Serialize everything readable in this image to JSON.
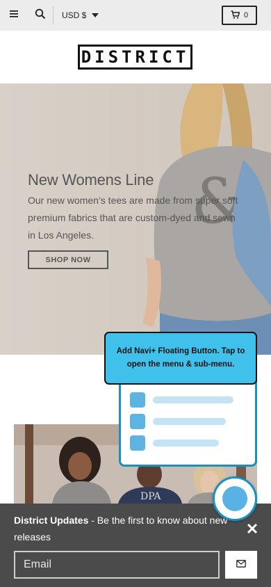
{
  "topbar": {
    "currency": "USD $",
    "cart_count": "0"
  },
  "header": {
    "logo": "DISTRICT"
  },
  "hero": {
    "title": "New Womens Line",
    "text": "Our new women’s tees are made from super soft premium fabrics that are custom-dyed and sewn in Los Angeles.",
    "button_label": "SHOP NOW"
  },
  "floating_button": {
    "tooltip": "Add Navi+ Floating Button. Tap to open the menu & sub-menu.",
    "accent": "#3fc1ec",
    "border": "#1a8fc1"
  },
  "newsletter": {
    "title": "District Updates",
    "message": " - Be the first to know about new releases",
    "email_placeholder": "Email"
  },
  "icons": {
    "menu": "hamburger-icon",
    "search": "search-icon",
    "cart": "cart-icon",
    "close": "close-icon",
    "submit": "mail-icon"
  }
}
